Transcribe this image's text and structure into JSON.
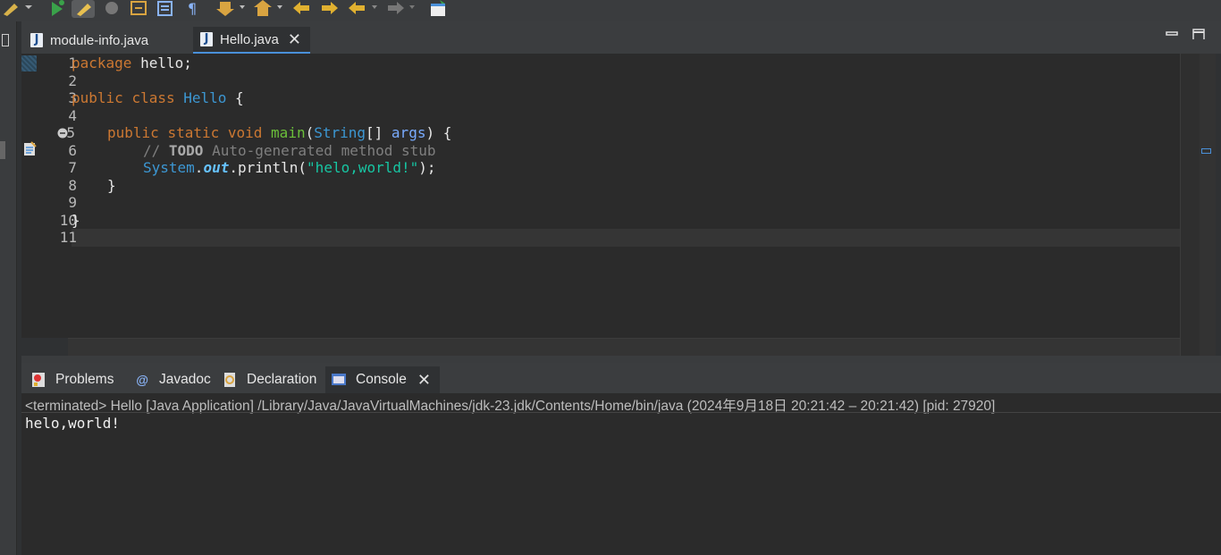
{
  "editor": {
    "tabs": [
      {
        "label": "module-info.java",
        "active": false
      },
      {
        "label": "Hello.java",
        "active": true
      }
    ],
    "line_numbers": [
      "1",
      "2",
      "3",
      "4",
      "5",
      "6",
      "7",
      "8",
      "9",
      "10",
      "11"
    ],
    "code": {
      "l1": {
        "kw": "package",
        "rest": " hello;"
      },
      "l3": {
        "kw1": "public",
        "kw2": "class",
        "name": "Hello",
        "brace": " {"
      },
      "l5": {
        "kw1": "public",
        "kw2": "static",
        "kw3": "void",
        "method": "main",
        "open": "(",
        "type": "String",
        "arr": "[] ",
        "param": "args",
        "close": ") {"
      },
      "l6": {
        "slashes": "// ",
        "todo": "TODO",
        "text": " Auto-generated method stub"
      },
      "l7": {
        "cls": "System",
        "dot1": ".",
        "field": "out",
        "call": ".println(",
        "str": "\"helo,world!\"",
        "end": ");"
      },
      "l8": "}",
      "l10": "}"
    }
  },
  "panel": {
    "tabs": [
      {
        "label": "Problems",
        "icon": "problems-icon"
      },
      {
        "label": "Javadoc",
        "icon": "javadoc-icon"
      },
      {
        "label": "Declaration",
        "icon": "declaration-icon"
      },
      {
        "label": "Console",
        "icon": "console-icon",
        "active": true
      }
    ]
  },
  "console": {
    "status": "<terminated> Hello [Java Application] /Library/Java/JavaVirtualMachines/jdk-23.jdk/Contents/Home/bin/java  (2024年9月18日 20:21:42 – 20:21:42) [pid: 27920]",
    "output": "helo,world!"
  },
  "colors": {
    "keyword": "#cc7832",
    "type": "#3c97d3",
    "string": "#17c6a3",
    "method": "#6bbf3a",
    "accent": "#4a90d9"
  }
}
